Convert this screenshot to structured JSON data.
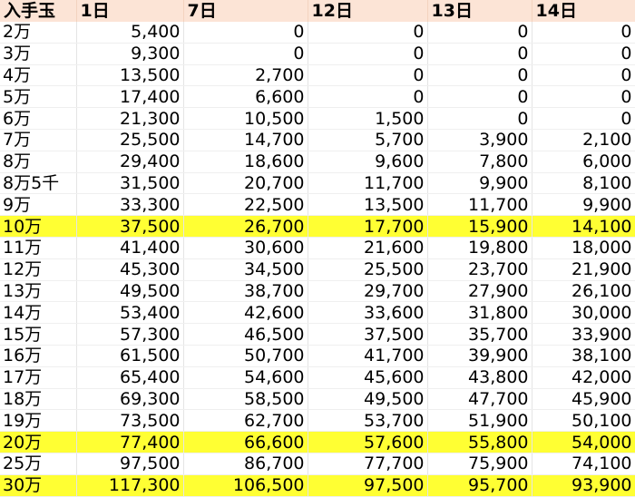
{
  "header": [
    "入手玉",
    "1日",
    "7日",
    "12日",
    "13日",
    "14日"
  ],
  "highlight_color": "#ffff33",
  "header_color": "#fce4d6",
  "rows": [
    {
      "label": "2万",
      "values": [
        "5,400",
        "0",
        "0",
        "0",
        "0"
      ],
      "highlight": false
    },
    {
      "label": "3万",
      "values": [
        "9,300",
        "0",
        "0",
        "0",
        "0"
      ],
      "highlight": false
    },
    {
      "label": "4万",
      "values": [
        "13,500",
        "2,700",
        "0",
        "0",
        "0"
      ],
      "highlight": false
    },
    {
      "label": "5万",
      "values": [
        "17,400",
        "6,600",
        "0",
        "0",
        "0"
      ],
      "highlight": false
    },
    {
      "label": "6万",
      "values": [
        "21,300",
        "10,500",
        "1,500",
        "0",
        "0"
      ],
      "highlight": false
    },
    {
      "label": "7万",
      "values": [
        "25,500",
        "14,700",
        "5,700",
        "3,900",
        "2,100"
      ],
      "highlight": false
    },
    {
      "label": "8万",
      "values": [
        "29,400",
        "18,600",
        "9,600",
        "7,800",
        "6,000"
      ],
      "highlight": false
    },
    {
      "label": "8万5千",
      "values": [
        "31,500",
        "20,700",
        "11,700",
        "9,900",
        "8,100"
      ],
      "highlight": false
    },
    {
      "label": "9万",
      "values": [
        "33,300",
        "22,500",
        "13,500",
        "11,700",
        "9,900"
      ],
      "highlight": false
    },
    {
      "label": "10万",
      "values": [
        "37,500",
        "26,700",
        "17,700",
        "15,900",
        "14,100"
      ],
      "highlight": true
    },
    {
      "label": "11万",
      "values": [
        "41,400",
        "30,600",
        "21,600",
        "19,800",
        "18,000"
      ],
      "highlight": false
    },
    {
      "label": "12万",
      "values": [
        "45,300",
        "34,500",
        "25,500",
        "23,700",
        "21,900"
      ],
      "highlight": false
    },
    {
      "label": "13万",
      "values": [
        "49,500",
        "38,700",
        "29,700",
        "27,900",
        "26,100"
      ],
      "highlight": false
    },
    {
      "label": "14万",
      "values": [
        "53,400",
        "42,600",
        "33,600",
        "31,800",
        "30,000"
      ],
      "highlight": false
    },
    {
      "label": "15万",
      "values": [
        "57,300",
        "46,500",
        "37,500",
        "35,700",
        "33,900"
      ],
      "highlight": false
    },
    {
      "label": "16万",
      "values": [
        "61,500",
        "50,700",
        "41,700",
        "39,900",
        "38,100"
      ],
      "highlight": false
    },
    {
      "label": "17万",
      "values": [
        "65,400",
        "54,600",
        "45,600",
        "43,800",
        "42,000"
      ],
      "highlight": false
    },
    {
      "label": "18万",
      "values": [
        "69,300",
        "58,500",
        "49,500",
        "47,700",
        "45,900"
      ],
      "highlight": false
    },
    {
      "label": "19万",
      "values": [
        "73,500",
        "62,700",
        "53,700",
        "51,900",
        "50,100"
      ],
      "highlight": false
    },
    {
      "label": "20万",
      "values": [
        "77,400",
        "66,600",
        "57,600",
        "55,800",
        "54,000"
      ],
      "highlight": true
    },
    {
      "label": "25万",
      "values": [
        "97,500",
        "86,700",
        "77,700",
        "75,900",
        "74,100"
      ],
      "highlight": false
    },
    {
      "label": "30万",
      "values": [
        "117,300",
        "106,500",
        "97,500",
        "95,700",
        "93,900"
      ],
      "highlight": true
    }
  ]
}
